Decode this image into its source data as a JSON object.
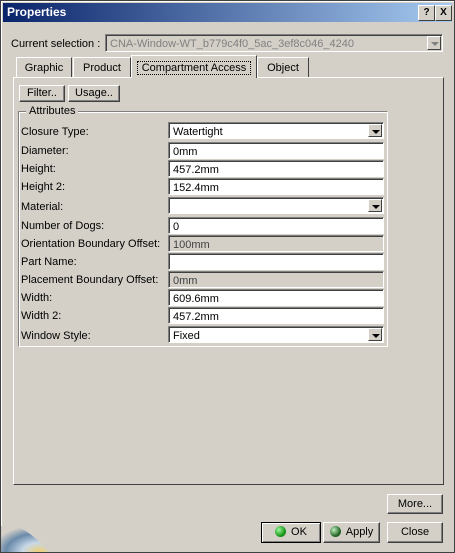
{
  "window": {
    "title": "Properties",
    "help_btn": "?",
    "close_btn": "X"
  },
  "selection": {
    "label": "Current selection :",
    "value": "CNA-Window-WT_b779c4f0_5ac_3ef8c046_4240"
  },
  "tabs": [
    {
      "label": "Graphic"
    },
    {
      "label": "Product"
    },
    {
      "label": "Compartment Access",
      "active": true
    },
    {
      "label": "Object"
    }
  ],
  "toolbar": {
    "filter": "Filter..",
    "usage": "Usage.."
  },
  "attributes": {
    "title": "Attributes",
    "rows": [
      {
        "label": "Closure Type:",
        "value": "Watertight",
        "kind": "dropdown"
      },
      {
        "label": "Diameter:",
        "value": "0mm",
        "kind": "text"
      },
      {
        "label": "Height:",
        "value": "457.2mm",
        "kind": "text"
      },
      {
        "label": "Height 2:",
        "value": "152.4mm",
        "kind": "text"
      },
      {
        "label": "Material:",
        "value": "",
        "kind": "dropdown"
      },
      {
        "label": "Number of Dogs:",
        "value": "0",
        "kind": "text"
      },
      {
        "label": "Orientation Boundary Offset:",
        "value": "100mm",
        "kind": "disabled"
      },
      {
        "label": "Part Name:",
        "value": "",
        "kind": "text"
      },
      {
        "label": "Placement Boundary Offset:",
        "value": "0mm",
        "kind": "disabled"
      },
      {
        "label": "Width:",
        "value": "609.6mm",
        "kind": "text"
      },
      {
        "label": "Width 2:",
        "value": "457.2mm",
        "kind": "text"
      },
      {
        "label": "Window Style:",
        "value": "Fixed",
        "kind": "dropdown"
      }
    ]
  },
  "footer": {
    "more": "More...",
    "ok": "OK",
    "apply": "Apply",
    "close": "Close"
  },
  "colors": {
    "title_start": "#0a246a",
    "title_end": "#a6caf0",
    "face": "#d4d0c8",
    "ok_dot": "#1a9a1a",
    "apply_dot": "#2a6a2a"
  }
}
